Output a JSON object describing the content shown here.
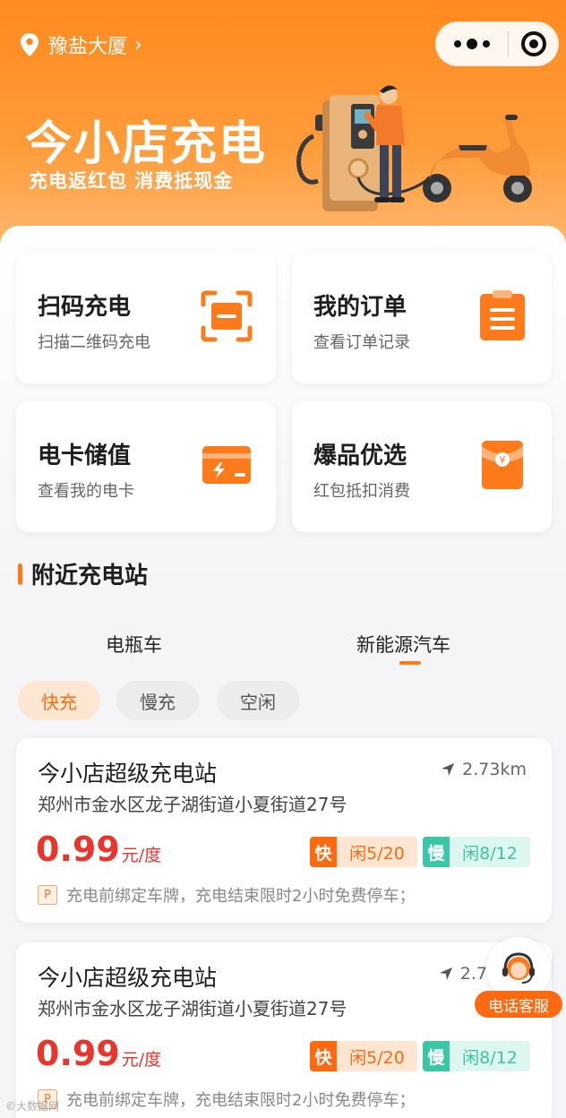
{
  "header": {
    "location": "豫盐大厦",
    "brand_title": "今小店充电",
    "brand_subtitle": "充电返红包 消费抵现金"
  },
  "tiles": [
    {
      "title": "扫码充电",
      "subtitle": "扫描二维码充电",
      "icon": "scan-icon"
    },
    {
      "title": "我的订单",
      "subtitle": "查看订单记录",
      "icon": "clipboard-icon"
    },
    {
      "title": "电卡储值",
      "subtitle": "查看我的电卡",
      "icon": "card-icon"
    },
    {
      "title": "爆品优选",
      "subtitle": "红包抵扣消费",
      "icon": "red-envelope-icon"
    }
  ],
  "nearby": {
    "title": "附近充电站",
    "tabs": [
      "电瓶车",
      "新能源汽车"
    ],
    "active_tab": "新能源汽车",
    "filters": [
      "快充",
      "慢充",
      "空闲"
    ],
    "active_filter": "快充"
  },
  "stations": [
    {
      "name": "今小店超级充电站",
      "distance": "2.73km",
      "address": "郑州市金水区龙子湖街道小夏街道27号",
      "price": "0.99",
      "unit": "元/度",
      "fast_tag": "快",
      "fast_value": "闲5/20",
      "slow_tag": "慢",
      "slow_value": "闲8/12",
      "note_tag": "P",
      "note": "充电前绑定车牌，充电结束限时2小时免费停车；"
    },
    {
      "name": "今小店超级充电站",
      "distance": "2.7",
      "address": "郑州市金水区龙子湖街道小夏街道27号",
      "price": "0.99",
      "unit": "元/度",
      "fast_tag": "快",
      "fast_value": "闲5/20",
      "slow_tag": "慢",
      "slow_value": "闲8/12",
      "note_tag": "P",
      "note": "充电前绑定车牌，充电结束限时2小时免费停车；"
    }
  ],
  "support": {
    "label": "电话客服"
  },
  "watermark": "©大数据网",
  "colors": {
    "accent": "#ff7a1a",
    "price": "#e9352b",
    "slow": "#3bc6a6"
  }
}
